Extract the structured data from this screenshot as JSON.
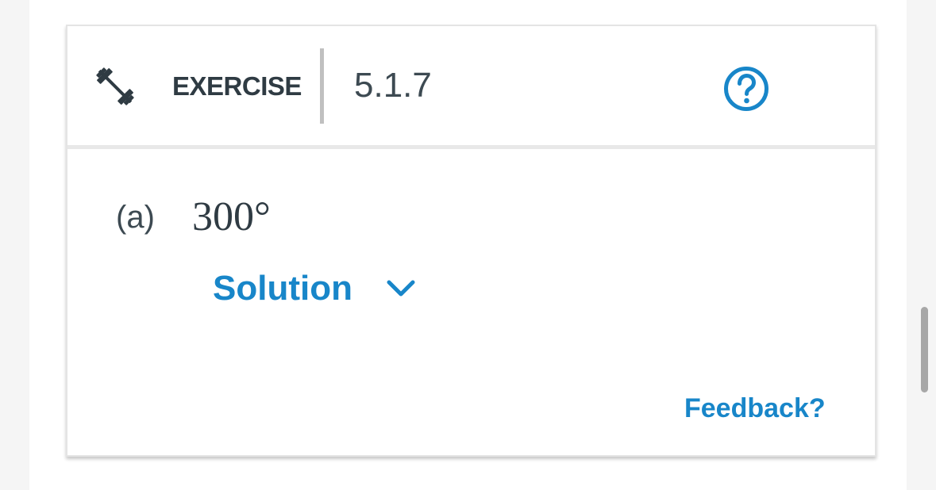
{
  "header": {
    "section_label": "EXERCISE",
    "exercise_number": "5.1.7",
    "icon": "dumbbell-icon",
    "help_icon": "question-mark-circle-icon"
  },
  "body": {
    "part_label": "(a)",
    "part_value": "300°",
    "solution_label": "Solution",
    "solution_icon": "chevron-down-icon",
    "feedback_label": "Feedback?"
  },
  "colors": {
    "accent": "#1886c9",
    "text": "#2f3b43",
    "divider": "#c0c0c0"
  }
}
